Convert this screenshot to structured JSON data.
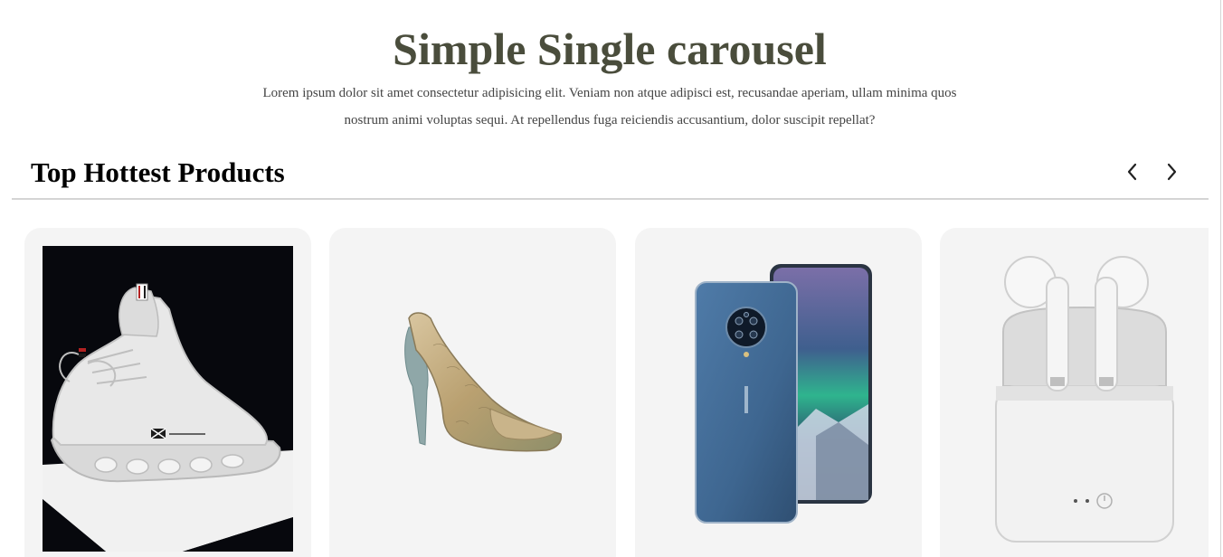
{
  "header": {
    "title": "Simple Single carousel",
    "description": "Lorem ipsum dolor sit amet consectetur adipisicing elit. Veniam non atque adipisci est, recusandae aperiam, ullam minima quos nostrum animi voluptas sequi. At repellendus fuga reiciendis accusantium, dolor suscipit repellat?"
  },
  "carousel": {
    "title": "Top Hottest Products",
    "prev_icon": "chevron-left-icon",
    "next_icon": "chevron-right-icon",
    "products": [
      {
        "image": "sneaker-image"
      },
      {
        "image": "high-heel-image"
      },
      {
        "image": "smartphone-image"
      },
      {
        "image": "earbuds-image"
      }
    ]
  },
  "colors": {
    "title": "#4a4d3c",
    "card_background": "#f4f4f4",
    "divider": "#d4d4d4"
  }
}
